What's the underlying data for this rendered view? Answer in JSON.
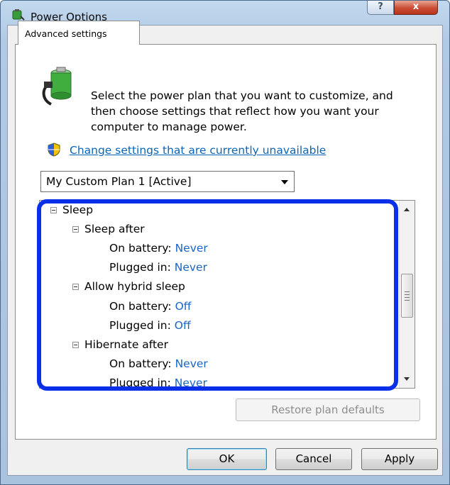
{
  "window": {
    "title": "Power Options"
  },
  "titlebar": {
    "help_label": "?",
    "close_label": "x"
  },
  "tab": {
    "label": "Advanced settings"
  },
  "intro": {
    "text": "Select the power plan that you want to customize, and then choose settings that reflect how you want your computer to manage power."
  },
  "link": {
    "label": "Change settings that are currently unavailable"
  },
  "plan_select": {
    "value": "My Custom Plan 1 [Active]"
  },
  "tree": {
    "sleep": "Sleep",
    "sleep_after": {
      "label": "Sleep after",
      "battery_label": "On battery:",
      "battery_value": "Never",
      "plugged_label": "Plugged in:",
      "plugged_value": "Never"
    },
    "hybrid": {
      "label": "Allow hybrid sleep",
      "battery_label": "On battery:",
      "battery_value": "Off",
      "plugged_label": "Plugged in:",
      "plugged_value": "Off"
    },
    "hibernate": {
      "label": "Hibernate after",
      "battery_label": "On battery:",
      "battery_value": "Never",
      "plugged_label": "Plugged in:",
      "plugged_value": "Never"
    }
  },
  "buttons": {
    "restore": "Restore plan defaults",
    "ok": "OK",
    "cancel": "Cancel",
    "apply": "Apply"
  },
  "colors": {
    "highlight": "#0a2fe8",
    "value_text": "#1a66c6",
    "link": "#0a66b7"
  },
  "icons": {
    "title": "power-options-icon",
    "battery": "battery-plug-icon",
    "shield": "uac-shield-icon"
  }
}
